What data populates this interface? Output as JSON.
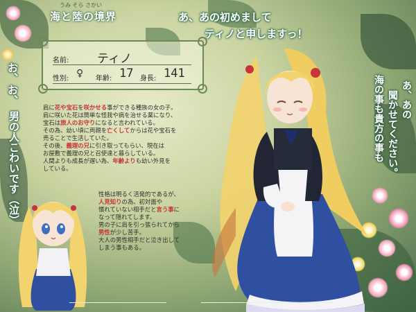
{
  "title": {
    "ruby": "うみ  そら  さかい",
    "text": "海と陸の境界"
  },
  "profile": {
    "name_label": "名前:",
    "name": "ティノ",
    "gender_label": "性別:",
    "gender": "♀",
    "age_label": "年齢:",
    "age": "17",
    "height_label": "身長:",
    "height": "141"
  },
  "greeting": {
    "line1": "あ、あの初めまして",
    "line2": "ティノと申しますっ！"
  },
  "right_dialogue": [
    "あ、あの",
    "聞かせてください。",
    "海の事も貴方の事も"
  ],
  "left_dialogue": [
    "お、",
    "お、",
    "男の人こわいです（泣）"
  ],
  "bio_lines_1": [
    [
      {
        "t": "肩に"
      },
      {
        "t": "花や宝石",
        "h": true
      },
      {
        "t": "を"
      },
      {
        "t": "咲かせる",
        "h": true
      },
      {
        "t": "事ができる種族の女の子。"
      }
    ],
    [
      {
        "t": "肩に咲いた花は簡単な怪我や病を治せる薬になり、"
      }
    ],
    [
      {
        "t": "宝石は"
      },
      {
        "t": "旅人のお守り",
        "h": true
      },
      {
        "t": "になると言われている。"
      }
    ],
    [
      {
        "t": "その為、幼い頃に両親を"
      },
      {
        "t": "亡くして",
        "h": true
      },
      {
        "t": "からは花や宝石を"
      }
    ],
    [
      {
        "t": "売ることで生活していた。"
      }
    ],
    [
      {
        "t": "その後、"
      },
      {
        "t": "義理の兄",
        "h": true
      },
      {
        "t": "に引き取ってもらい、現在は"
      }
    ],
    [
      {
        "t": "お屋敷で義理の兄と召使達と暮らしている。"
      }
    ],
    [
      {
        "t": "人間よりも成長が遅い為、"
      },
      {
        "t": "年齢より",
        "h": true
      },
      {
        "t": "も幼い外見を"
      }
    ],
    [
      {
        "t": "                              している。"
      }
    ]
  ],
  "bio_lines_2": [
    [
      {
        "t": "性格は明るく活発的であるが、"
      }
    ],
    [
      {
        "t": "人見知り",
        "h": true
      },
      {
        "t": "の為、初対面や"
      }
    ],
    [
      {
        "t": "慣れていない相手だと"
      },
      {
        "t": "言う事",
        "h": true
      },
      {
        "t": "に"
      }
    ],
    [
      {
        "t": "なって隠れてします。"
      }
    ],
    [
      {
        "t": "男の子に肩を引っ張られてから"
      }
    ],
    [
      {
        "t": "男性",
        "h": true
      },
      {
        "t": "が少し苦手。"
      }
    ],
    [
      {
        "t": "大人の男性相手だと泣き出して"
      }
    ],
    [
      {
        "t": "しまう事もある。"
      }
    ]
  ],
  "colors": {
    "highlight": "#c7303c",
    "frame": "#6d8a55",
    "outline": "#2d6b4b",
    "dress": "#2f4fa0",
    "hair": "#f3d36e"
  }
}
